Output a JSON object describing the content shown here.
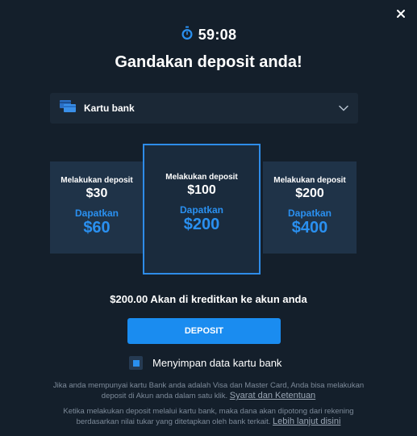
{
  "timer": {
    "value": "59:08"
  },
  "title": "Gandakan deposit anda!",
  "payment_method": {
    "label": "Kartu bank"
  },
  "offers": [
    {
      "deposit_label": "Melakukan deposit",
      "deposit_amount": "$30",
      "get_label": "Dapatkan",
      "get_amount": "$60"
    },
    {
      "deposit_label": "Melakukan deposit",
      "deposit_amount": "$100",
      "get_label": "Dapatkan",
      "get_amount": "$200",
      "selected": true
    },
    {
      "deposit_label": "Melakukan deposit",
      "deposit_amount": "$200",
      "get_label": "Dapatkan",
      "get_amount": "$400"
    }
  ],
  "credit_text": "$200.00 Akan di kreditkan ke akun anda",
  "deposit_button": "DEPOSIT",
  "save_card": {
    "label": "Menyimpan data kartu bank",
    "checked": true
  },
  "info1": {
    "text": "Jika anda mempunyai kartu Bank anda adalah Visa dan Master Card, Anda bisa melakukan deposit di Akun anda dalam satu klik.",
    "link": "Syarat dan Ketentuan"
  },
  "info2": {
    "text": "Ketika melakukan deposit melalui kartu bank, maka dana akan dipotong dari rekening berdasarkan nilai tukar yang ditetapkan oleh bank terkait.",
    "link": "Lebih lanjut disini"
  },
  "colors": {
    "background": "#141f2b",
    "accent": "#1a8cf0",
    "card": "#1f3348"
  },
  "icons": {
    "timer": "stopwatch-icon",
    "method": "bank-card-icon",
    "dropdown": "chevron-down-icon",
    "close": "close-icon"
  }
}
